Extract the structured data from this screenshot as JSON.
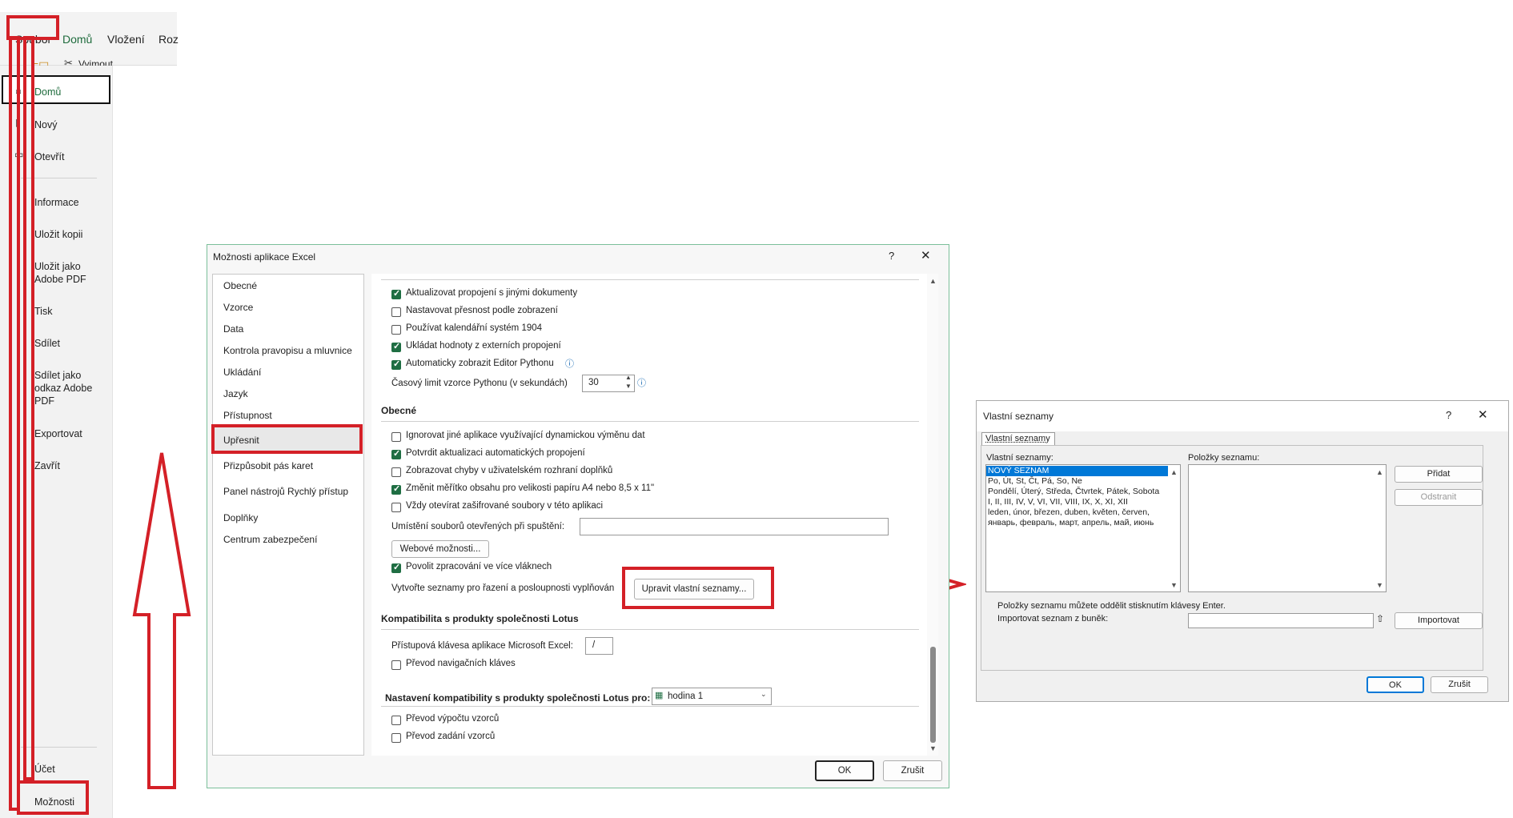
{
  "ribbon": {
    "tabs": [
      "Soubor",
      "Domů",
      "Vložení",
      "Roz"
    ],
    "cut_label": "Vyjmout"
  },
  "backstage": {
    "items": [
      "Domů",
      "Nový",
      "Otevřít",
      "Informace",
      "Uložit kopii",
      "Uložit jako Adobe PDF",
      "Tisk",
      "Sdílet",
      "Sdílet jako odkaz Adobe PDF",
      "Exportovat",
      "Zavřít"
    ],
    "bottom_items": [
      "Účet",
      "Možnosti"
    ]
  },
  "options_dialog": {
    "title": "Možnosti aplikace Excel",
    "help": "?",
    "close": "✕",
    "categories": [
      "Obecné",
      "Vzorce",
      "Data",
      "Kontrola pravopisu a mluvnice",
      "Ukládání",
      "Jazyk",
      "Přístupnost",
      "Upřesnit",
      "Přizpůsobit pás karet",
      "Panel nástrojů Rychlý přístup",
      "Doplňky",
      "Centrum zabezpečení"
    ],
    "selected_category": "Upřesnit",
    "top_options": [
      {
        "label": "Aktualizovat propojení s jinými dokumenty",
        "checked": true
      },
      {
        "label": "Nastavovat přesnost podle zobrazení",
        "checked": false
      },
      {
        "label": "Používat kalendářní systém 1904",
        "checked": false
      },
      {
        "label": "Ukládat hodnoty z externích propojení",
        "checked": true
      },
      {
        "label": "Automaticky zobrazit Editor Pythonu",
        "checked": true
      }
    ],
    "python_limit_label": "Časový limit vzorce Pythonu (v sekundách)",
    "python_limit_value": "30",
    "general_section": "Obecné",
    "general_options": [
      {
        "label": "Ignorovat jiné aplikace využívající dynamickou výměnu dat",
        "checked": false
      },
      {
        "label": "Potvrdit aktualizaci automatických propojení",
        "checked": true
      },
      {
        "label": "Zobrazovat chyby v uživatelském rozhraní doplňků",
        "checked": false
      },
      {
        "label": "Změnit měřítko obsahu pro velikosti papíru A4 nebo 8,5 x 11\"",
        "checked": true
      },
      {
        "label": "Vždy otevírat zašifrované soubory v této aplikaci",
        "checked": false
      }
    ],
    "startup_location_label": "Umístění souborů otevřených při spuštění:",
    "startup_location_value": "",
    "web_options_button": "Webové možnosti...",
    "multithread_label": "Povolit zpracování ve více vláknech",
    "multithread_checked": true,
    "custom_lists_label": "Vytvořte seznamy pro řazení a posloupnosti vyplňován",
    "custom_lists_button": "Upravit vlastní seznamy...",
    "lotus_section": "Kompatibilita s produkty společnosti Lotus",
    "lotus_key_label": "Přístupová klávesa aplikace Microsoft Excel:",
    "lotus_key_value": "/",
    "lotus_nav_label": "Převod navigačních kláves",
    "lotus_settings_label": "Nastavení kompatibility s produkty společnosti Lotus pro:",
    "lotus_sheet": "hodina 1",
    "lotus_options": [
      {
        "label": "Převod výpočtu vzorců",
        "checked": false
      },
      {
        "label": "Převod zadání vzorců",
        "checked": false
      }
    ],
    "ok": "OK",
    "cancel": "Zrušit"
  },
  "lists_dialog": {
    "title": "Vlastní seznamy",
    "help": "?",
    "close": "✕",
    "tab": "Vlastní seznamy",
    "lists_label": "Vlastní seznamy:",
    "lists": [
      "NOVÝ SEZNAM",
      "Po, Út, St, Čt, Pá, So, Ne",
      "Pondělí, Úterý, Středa, Čtvrtek, Pátek, Sobota",
      "I, II, III, IV, V, VI, VII, VIII, IX, X, XI, XII",
      "leden, únor, březen, duben, květen, červen,",
      "январь, февраль, март, апрель, май, июнь"
    ],
    "entries_label": "Položky seznamu:",
    "add": "Přidat",
    "remove": "Odstranit",
    "hint": "Položky seznamu můžete oddělit stisknutím klávesy Enter.",
    "import_label": "Importovat seznam z buněk:",
    "import_button": "Importovat",
    "ok": "OK",
    "cancel": "Zrušit"
  },
  "colors": {
    "accent": "#1f6e43",
    "highlight": "#d42027",
    "selection": "#0078d7"
  }
}
